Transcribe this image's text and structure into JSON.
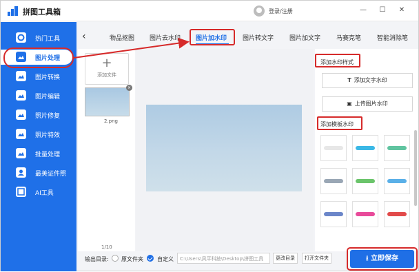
{
  "app": {
    "title": "拼图工具箱",
    "login": "登录/注册"
  },
  "window": {
    "minimize": "—",
    "maximize": "☐",
    "close": "✕"
  },
  "sidebar": {
    "items": [
      {
        "label": "热门工具",
        "icon": "hot-tools-icon"
      },
      {
        "label": "图片处理",
        "icon": "image-process-icon",
        "active": true
      },
      {
        "label": "图片转换",
        "icon": "image-convert-icon"
      },
      {
        "label": "图片编辑",
        "icon": "image-edit-icon"
      },
      {
        "label": "照片修复",
        "icon": "photo-repair-icon"
      },
      {
        "label": "照片特效",
        "icon": "photo-effects-icon"
      },
      {
        "label": "批量处理",
        "icon": "batch-process-icon"
      },
      {
        "label": "最美证件照",
        "icon": "id-photo-icon"
      },
      {
        "label": "AI工具",
        "icon": "ai-tools-icon"
      }
    ]
  },
  "tabs": {
    "back": "‹",
    "items": [
      "物品抠图",
      "图片去水印",
      "图片加水印",
      "图片转文字",
      "图片加文字",
      "马赛克笔",
      "智能消除笔"
    ],
    "active_index": 2
  },
  "files": {
    "add_label": "添加文件",
    "add_symbol": "+",
    "remove_symbol": "×",
    "thumb_name": "2.png",
    "page_count": "1/10"
  },
  "right_panel": {
    "section1": "添加水印样式",
    "add_text_btn": "添加文字水印",
    "add_text_icon_glyph": "T",
    "upload_img_btn": "上传图片水印",
    "section2": "添加模板水印",
    "template_colors": [
      "#e7e7e7",
      "#3bb8e6",
      "#60c4a0",
      "#9aa7b5",
      "#6bc46b",
      "#5ab0e8",
      "#6b86c9",
      "#e84a9a",
      "#e24a4a"
    ]
  },
  "bottom": {
    "output_label": "输出目录:",
    "option_original": "原文件夹",
    "option_custom": "自定义",
    "path": "C:\\Users\\风平科技\\Desktop\\拼图工具",
    "change_dir": "更改目录",
    "open_folder": "打开文件夹",
    "save": "立即保存"
  },
  "colors": {
    "brand": "#1f70e8",
    "annotation": "#d62a2a"
  }
}
